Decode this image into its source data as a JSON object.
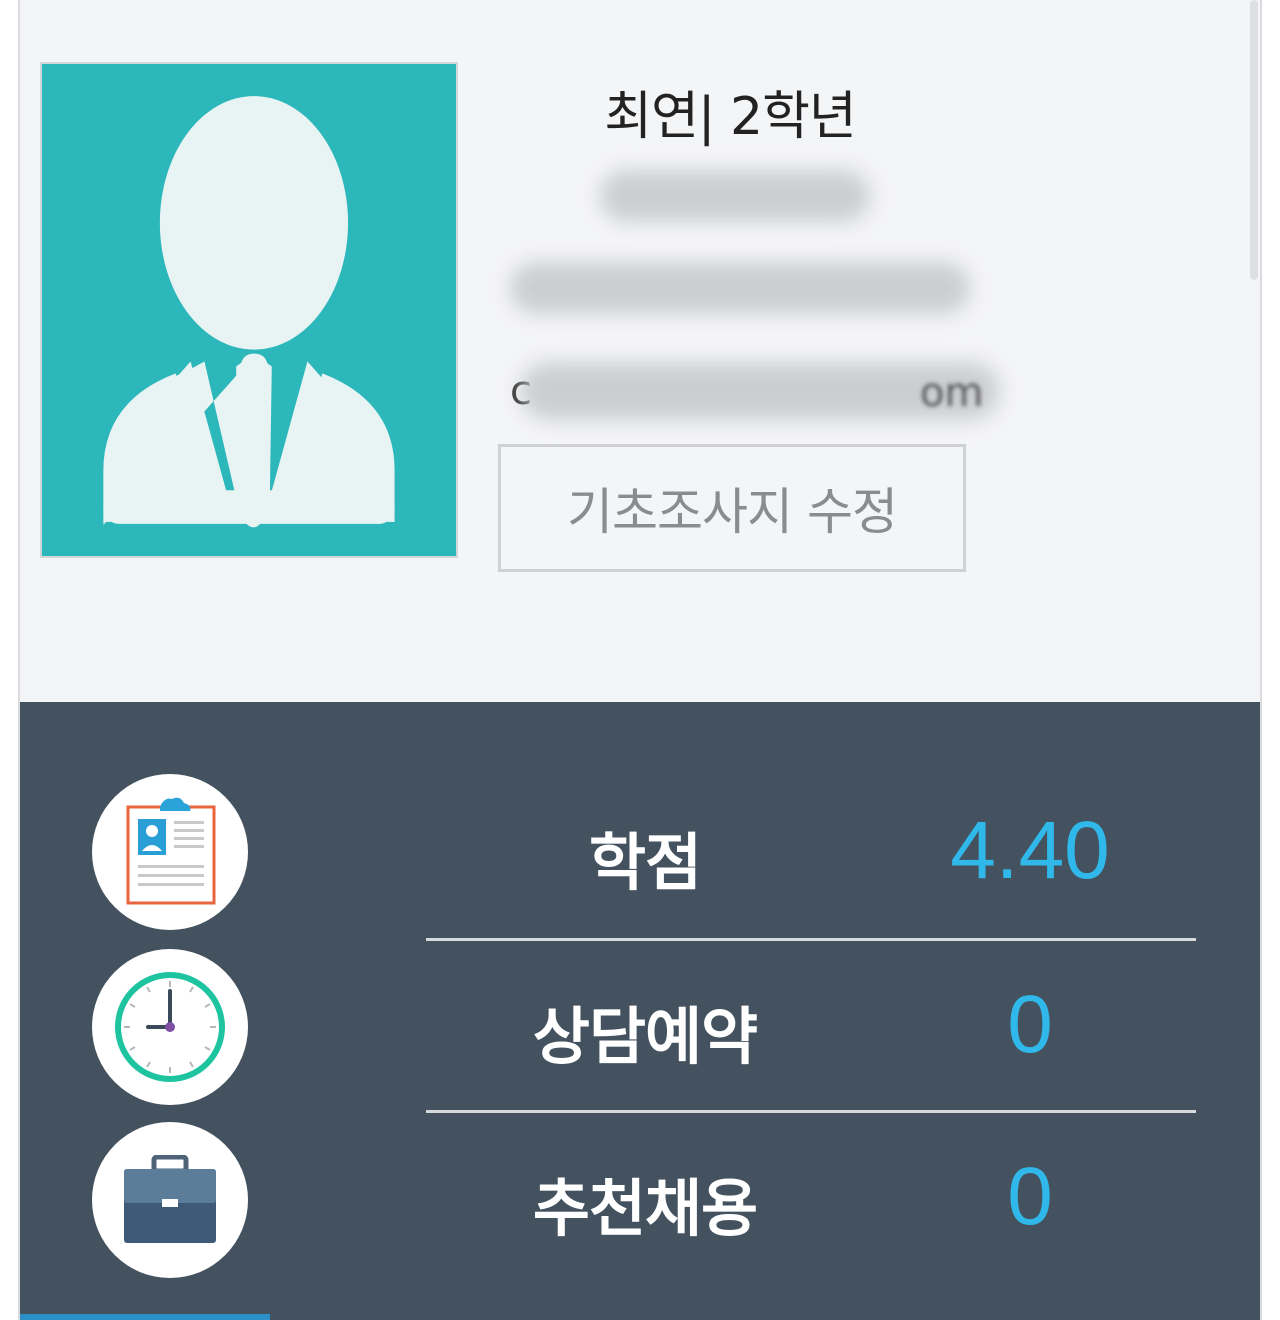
{
  "profile": {
    "name_grade": "최연| 2학년",
    "email_prefix": "c",
    "email_suffix": "om",
    "edit_button": "기초조사지 수정"
  },
  "stats": [
    {
      "label": "학점",
      "value": "4.40",
      "icon": "resume-icon"
    },
    {
      "label": "상담예약",
      "value": "0",
      "icon": "clock-icon"
    },
    {
      "label": "추천채용",
      "value": "0",
      "icon": "briefcase-icon"
    }
  ],
  "colors": {
    "avatar_bg": "#2cb7bb",
    "stats_panel_bg": "#44525f",
    "value_accent": "#2fb8e9",
    "card_bg": "#f4f5f7"
  }
}
